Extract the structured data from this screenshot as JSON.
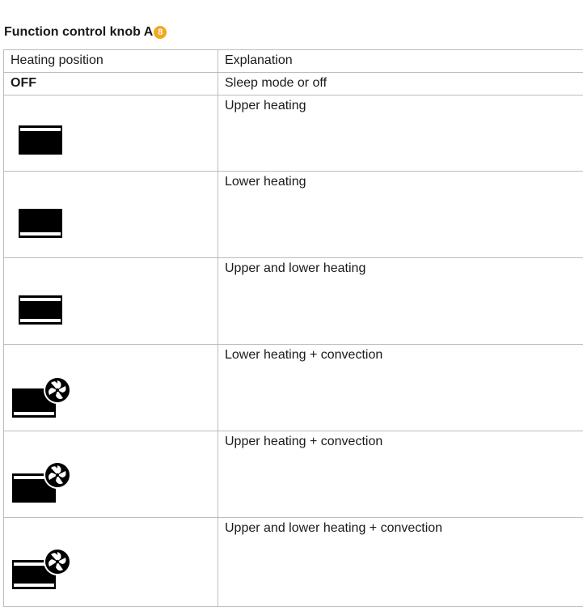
{
  "title": {
    "text": "Function control knob A",
    "badge": "8"
  },
  "colors": {
    "badge": "#f2a81d",
    "border": "#bdbdbd",
    "text": "#1a1a1a"
  },
  "table": {
    "headers": {
      "position": "Heating position",
      "explanation": "Explanation"
    },
    "rows": [
      {
        "position": "OFF",
        "explanation": "Sleep mode or off"
      },
      {
        "icon": "upper-heating-icon",
        "explanation": "Upper heating"
      },
      {
        "icon": "lower-heating-icon",
        "explanation": "Lower heating"
      },
      {
        "icon": "upper-lower-heating-icon",
        "explanation": "Upper and lower heating"
      },
      {
        "icon": "lower-heating-convection-icon",
        "explanation": "Lower heating + convection"
      },
      {
        "icon": "upper-heating-convection-icon",
        "explanation": "Upper heating + convection"
      },
      {
        "icon": "upper-lower-heating-convection-icon",
        "explanation": "Upper and lower heating + convection"
      }
    ]
  }
}
